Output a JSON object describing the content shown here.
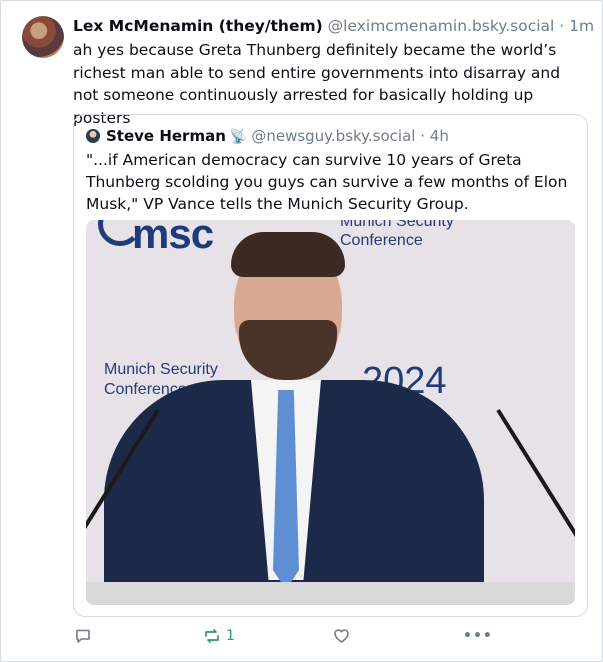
{
  "post": {
    "author": {
      "name": "Lex McMenamin (they/them)",
      "handle": "@leximcmenamin.bsky.social",
      "separator": "·",
      "time": "1m"
    },
    "text": "ah yes because Greta Thunberg definitely became the world’s richest man able to send entire governments into disarray and not someone continuously arrested for basically holding up posters"
  },
  "quote": {
    "author": {
      "name": "Steve Herman",
      "badge_icon": "satellite-icon",
      "handle": "@newsguy.bsky.social",
      "separator": "·",
      "time": "4h"
    },
    "text": "\"...if American democracy can survive 10 years of Greta Thunberg scolding you guys can survive a few months of Elon Musk,\" VP Vance tells the Munich Security Group.",
    "image": {
      "logo_text": "msc",
      "conference_top": "Munich Security\nConference",
      "munich_text": "Munich Security\nConference",
      "year_text": "2024"
    }
  },
  "actions": {
    "reply_icon": "reply-icon",
    "repost_icon": "repost-icon",
    "repost_count": "1",
    "like_icon": "heart-icon",
    "more_icon": "more-icon",
    "more_label": "•••"
  },
  "colors": {
    "text": "#0b0f14",
    "muted": "#6f7d8c",
    "border": "#d4dbe2",
    "repost": "#20a35c"
  }
}
